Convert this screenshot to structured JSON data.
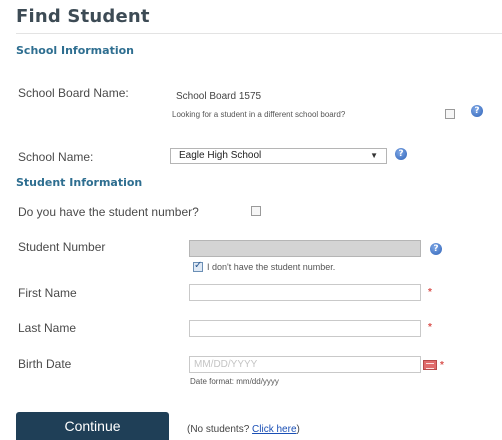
{
  "title": "Find Student",
  "school_info": {
    "heading": "School Information",
    "board_label": "School Board Name:",
    "board_value": "School Board 1575",
    "different_board_text": "Looking for a student in a different school board?",
    "school_label": "School Name:",
    "school_value": "Eagle High School"
  },
  "student_info": {
    "heading": "Student Information",
    "have_number_label": "Do you have the student number?",
    "student_number_label": "Student Number",
    "no_number_text": "I don't have the student number.",
    "first_name_label": "First Name",
    "last_name_label": "Last Name",
    "birth_date_label": "Birth Date",
    "birth_date_placeholder": "MM/DD/YYYY",
    "date_format_hint": "Date format: mm/dd/yyyy",
    "required_mark": "*"
  },
  "actions": {
    "continue_label": "Continue",
    "no_students_prefix": "(No students? ",
    "click_here_label": "Click here",
    "no_students_suffix": ")"
  },
  "icons": {
    "help": "?",
    "dropdown": "▼"
  },
  "colors": {
    "section_heading": "#2e6e90",
    "button_bg": "#1f3f57",
    "help_icon": "#2f63b8",
    "required": "#d9534f",
    "link": "#1a4fb5"
  }
}
